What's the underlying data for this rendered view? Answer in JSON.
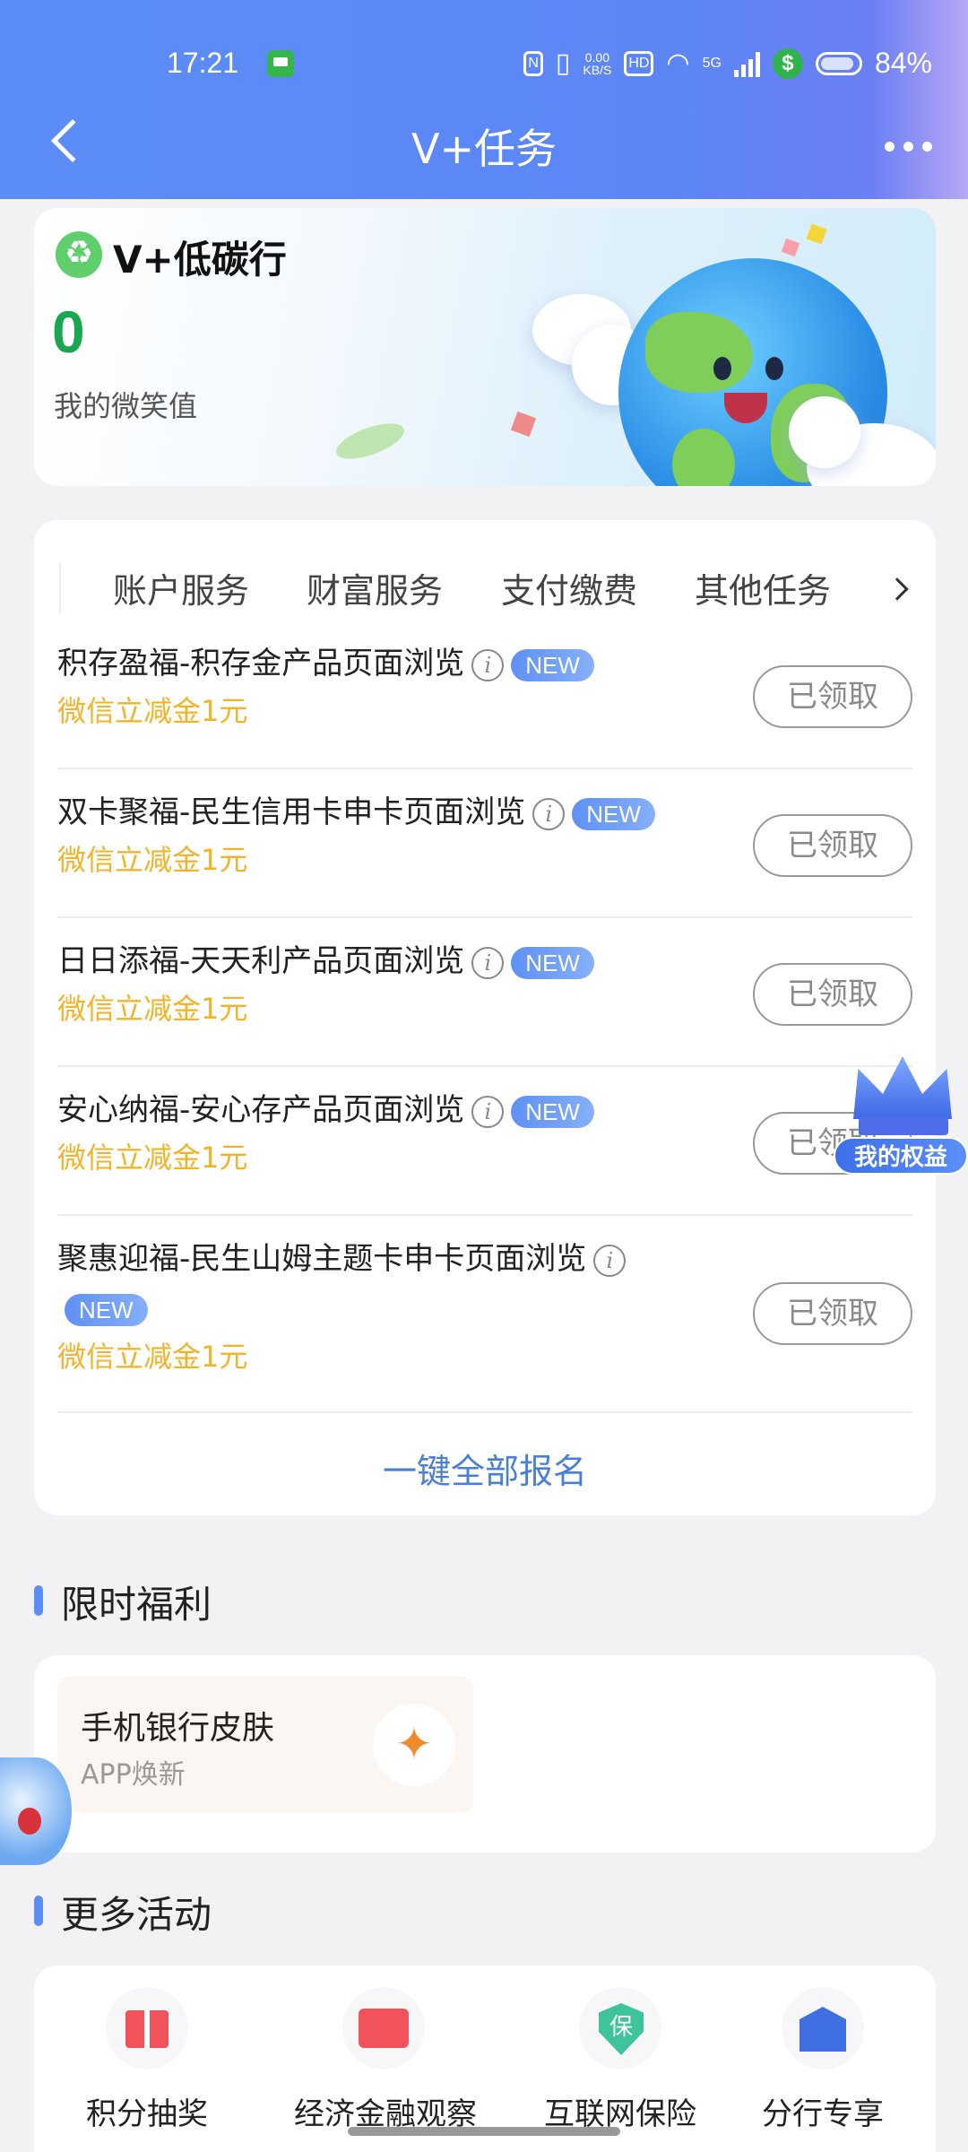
{
  "status_bar": {
    "time": "17:21",
    "speed_value": "0.00",
    "speed_unit": "KB/S",
    "hd": "HD",
    "network": "5G",
    "battery": "84%"
  },
  "header": {
    "title": "V+任务"
  },
  "banner": {
    "title": "V+低碳行",
    "value": "0",
    "subtitle": "我的微笑值"
  },
  "tabs": [
    {
      "label": "账户服务"
    },
    {
      "label": "财富服务"
    },
    {
      "label": "支付缴费"
    },
    {
      "label": "其他任务"
    }
  ],
  "tasks": [
    {
      "name": "积存盈福-积存金产品页面浏览",
      "badge": "NEW",
      "reward": "微信立减金1元",
      "button": "已领取"
    },
    {
      "name": "双卡聚福-民生信用卡申卡页面浏览",
      "badge": "NEW",
      "reward": "微信立减金1元",
      "button": "已领取"
    },
    {
      "name": "日日添福-天天利产品页面浏览",
      "badge": "NEW",
      "reward": "微信立减金1元",
      "button": "已领取"
    },
    {
      "name": "安心纳福-安心存产品页面浏览",
      "badge": "NEW",
      "reward": "微信立减金1元",
      "button": "已领取"
    },
    {
      "name": "聚惠迎福-民生山姆主题卡申卡页面浏览",
      "badge": "NEW",
      "reward": "微信立减金1元",
      "button": "已领取"
    }
  ],
  "signup_all": "一键全部报名",
  "floating_badge": "我的权益",
  "limited_section": {
    "title": "限时福利",
    "item_title": "手机银行皮肤",
    "item_subtitle": "APP焕新"
  },
  "more_section": {
    "title": "更多活动",
    "shield_char": "保",
    "items": [
      {
        "label": "积分抽奖"
      },
      {
        "label": "经济金融观察"
      },
      {
        "label": "互联网保险"
      },
      {
        "label": "分行专享"
      }
    ]
  },
  "colors": {
    "header_blue": "#5b8df7",
    "reward_orange": "#f3b329",
    "link_blue": "#4a7fd6",
    "value_green": "#19a84f"
  }
}
